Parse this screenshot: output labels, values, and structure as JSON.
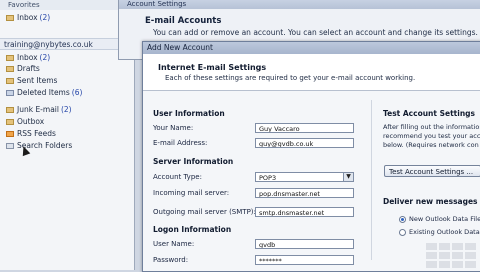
{
  "nav": {
    "favorites_header": "Favorites",
    "inbox_fav": {
      "label": "Inbox",
      "count": "(2)"
    },
    "account": "training@nybytes.co.uk",
    "folders": [
      {
        "label": "Inbox",
        "count": "(2)"
      },
      {
        "label": "Drafts",
        "count": ""
      },
      {
        "label": "Sent Items",
        "count": ""
      },
      {
        "label": "Deleted Items",
        "count": "(6)"
      },
      {
        "label": "Junk E-mail",
        "count": "(2)"
      },
      {
        "label": "Outbox",
        "count": ""
      },
      {
        "label": "RSS Feeds",
        "count": ""
      },
      {
        "label": "Search Folders",
        "count": ""
      }
    ]
  },
  "account_settings": {
    "title": "Account Settings",
    "heading": "E-mail Accounts",
    "description": "You can add or remove an account. You can select an account and change its settings."
  },
  "dialog": {
    "title": "Add New Account",
    "header_title": "Internet E-mail Settings",
    "header_desc": "Each of these settings are required to get your e-mail account working.",
    "user_info": {
      "section": "User Information",
      "name_label": "Your Name:",
      "name_value": "Guy Vaccaro",
      "email_label": "E-mail Address:",
      "email_value": "guy@gvdb.co.uk"
    },
    "server_info": {
      "section": "Server Information",
      "type_label": "Account Type:",
      "type_value": "POP3",
      "incoming_label": "Incoming mail server:",
      "incoming_value": "pop.dnsmaster.net",
      "outgoing_label": "Outgoing mail server (SMTP):",
      "outgoing_value": "smtp.dnsmaster.net"
    },
    "logon_info": {
      "section": "Logon Information",
      "username_label": "User Name:",
      "username_value": "gvdb",
      "password_label": "Password:",
      "password_value": "*******"
    },
    "test": {
      "title": "Test Account Settings",
      "text_1": "After filling out the information",
      "text_2": "recommend you test your account",
      "text_3": "below. (Requires network con",
      "button": "Test Account Settings ..."
    },
    "deliver": {
      "title": "Deliver new messages to:",
      "option_new": "New Outlook Data File",
      "option_existing": "Existing Outlook Data File"
    }
  }
}
